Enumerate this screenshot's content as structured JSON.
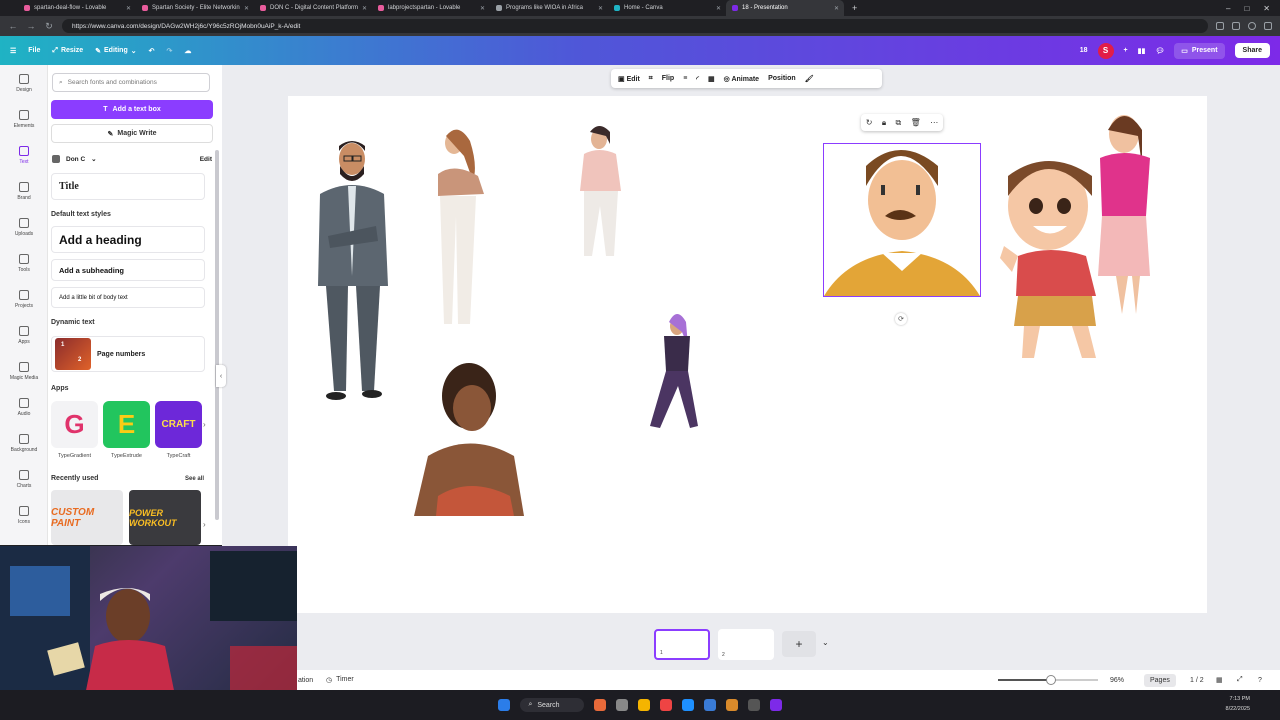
{
  "browser": {
    "tabs": [
      {
        "title": "spartan-deal-flow - Lovable",
        "color": "#e85c9c"
      },
      {
        "title": "Spartan Society - Elite Networkin",
        "color": "#e85c9c"
      },
      {
        "title": "DON C - Digital Content Platform",
        "color": "#e85c9c"
      },
      {
        "title": "labprojectspartan - Lovable",
        "color": "#e85c9c"
      },
      {
        "title": "Programs like WIOA in Africa",
        "color": "#9aa0a6"
      },
      {
        "title": "Home - Canva",
        "color": "#1fb3c4"
      },
      {
        "title": "18 - Presentation",
        "color": "#7d2ae8",
        "active": true
      }
    ],
    "url": "https://www.canva.com/design/DAGw2WH2j6c/Y96c5zROjMobn0uAiP_k-A/edit"
  },
  "canva_bar": {
    "file": "File",
    "resize": "Resize",
    "editing": "Editing",
    "count": "18",
    "avatar_letter": "S",
    "present": "Present",
    "share": "Share"
  },
  "rail": [
    {
      "label": "Design",
      "icon": "design-icon"
    },
    {
      "label": "Elements",
      "icon": "elements-icon"
    },
    {
      "label": "Text",
      "icon": "text-icon",
      "active": true
    },
    {
      "label": "Brand",
      "icon": "brand-icon"
    },
    {
      "label": "Uploads",
      "icon": "uploads-icon"
    },
    {
      "label": "Tools",
      "icon": "tools-icon"
    },
    {
      "label": "Projects",
      "icon": "projects-icon"
    },
    {
      "label": "Apps",
      "icon": "apps-icon"
    },
    {
      "label": "Magic Media",
      "icon": "magic-media-icon"
    },
    {
      "label": "Audio",
      "icon": "audio-icon"
    },
    {
      "label": "Background",
      "icon": "background-icon"
    },
    {
      "label": "Charts",
      "icon": "charts-icon"
    },
    {
      "label": "Icons",
      "icon": "icons-icon"
    }
  ],
  "panel": {
    "search_placeholder": "Search fonts and combinations",
    "add_text_box": "Add a text box",
    "magic_write": "Magic Write",
    "brand": "Don C",
    "edit": "Edit",
    "title_sample": "Title",
    "default_styles": "Default text styles",
    "heading": "Add a heading",
    "subheading": "Add a subheading",
    "body": "Add a little bit of body text",
    "dynamic_text": "Dynamic text",
    "page_numbers": "Page numbers",
    "apps_title": "Apps",
    "apps": [
      {
        "name": "TypeGradient",
        "glyph": "G",
        "bg": "#f3f3f5",
        "fg": "#e0336b"
      },
      {
        "name": "TypeExtrude",
        "glyph": "E",
        "bg": "#22c55e",
        "fg": "#facc15"
      },
      {
        "name": "TypeCraft",
        "glyph": "CRAFT",
        "bg": "#6d28d9",
        "fg": "#fde047"
      }
    ],
    "recently_used": "Recently used",
    "see_all": "See all",
    "recent": [
      "CUSTOM PAINT",
      "POWER WORKOUT"
    ]
  },
  "context_toolbar": {
    "edit": "Edit",
    "flip": "Flip",
    "animate": "Animate",
    "position": "Position"
  },
  "pages": {
    "thumb1": "1",
    "thumb2": "2",
    "page_label": "ation",
    "timer": "Timer",
    "zoom": "96%",
    "pages_btn": "Pages",
    "page_count": "1 / 2",
    "zoom_level": 0.53
  },
  "taskbar": {
    "search": "Search",
    "time": "7:13 PM",
    "date": "8/22/2025"
  },
  "colors": {
    "accent": "#8b3dff",
    "gradient_start": "#1fb3c4",
    "gradient_end": "#7d2ae8"
  }
}
